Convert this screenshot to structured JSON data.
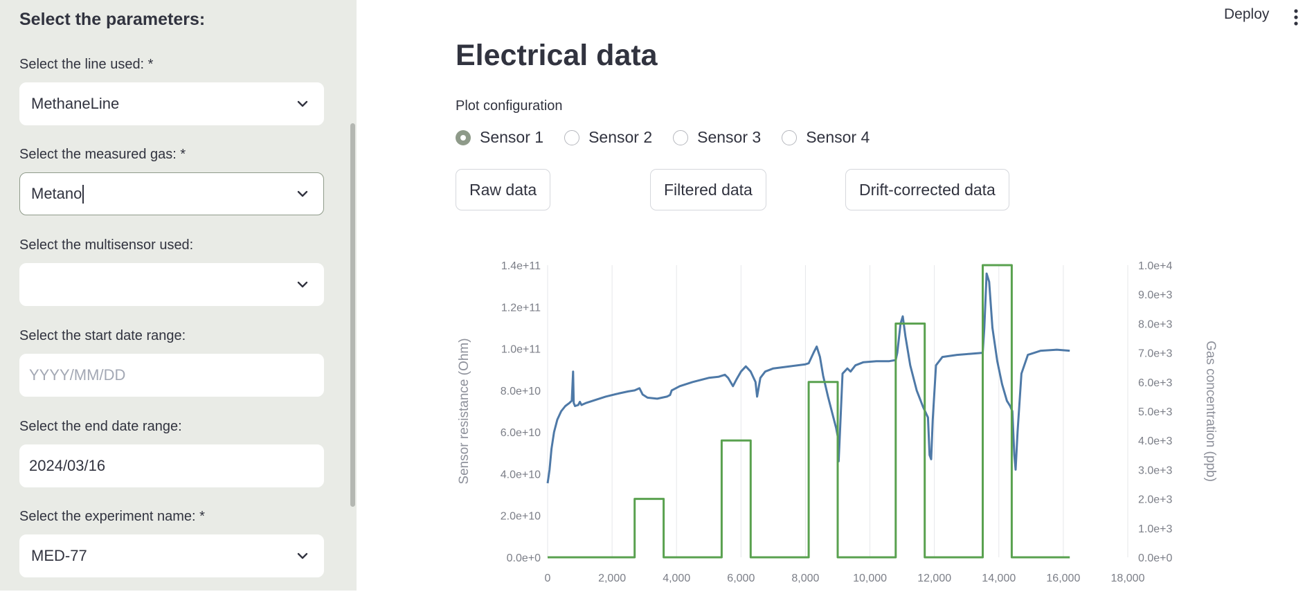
{
  "sidebar": {
    "header": "Select the parameters:",
    "line": {
      "label": "Select the line used: *",
      "value": "MethaneLine"
    },
    "gas": {
      "label": "Select the measured gas: *",
      "value": "Metano"
    },
    "multisensor": {
      "label": "Select the multisensor used:",
      "value": ""
    },
    "start_date": {
      "label": "Select the start date range:",
      "placeholder": "YYYY/MM/DD"
    },
    "end_date": {
      "label": "Select the end date range:",
      "value": "2024/03/16"
    },
    "experiment": {
      "label": "Select the experiment name: *",
      "value": "MED-77"
    }
  },
  "topbar": {
    "deploy_label": "Deploy",
    "menu_icon": "kebab-menu-icon"
  },
  "main": {
    "title": "Electrical data",
    "plot_config_label": "Plot configuration",
    "radios": [
      {
        "label": "Sensor 1",
        "checked": true
      },
      {
        "label": "Sensor 2",
        "checked": false
      },
      {
        "label": "Sensor 3",
        "checked": false
      },
      {
        "label": "Sensor 4",
        "checked": false
      }
    ],
    "buttons": {
      "raw": "Raw data",
      "filtered": "Filtered data",
      "drift": "Drift-corrected data"
    }
  },
  "colors": {
    "resistance_line": "#4e79a7",
    "concentration_line": "#59a14f",
    "accent": "#8e9a89",
    "sidebar_bg": "#e9ebe6"
  },
  "chart_data": {
    "type": "line",
    "xlabel": "",
    "ylabel": "Sensor resistance (Ohm)",
    "y2label": "Gas concentration (ppb)",
    "x_ticks": [
      "0",
      "2,000",
      "4,000",
      "6,000",
      "8,000",
      "10,000",
      "12,000",
      "14,000",
      "16,000",
      "18,000"
    ],
    "x_tick_values": [
      0,
      2000,
      4000,
      6000,
      8000,
      10000,
      12000,
      14000,
      16000,
      18000
    ],
    "y_ticks": [
      "0.0e+0",
      "2.0e+10",
      "4.0e+10",
      "6.0e+10",
      "8.0e+10",
      "1.0e+11",
      "1.2e+11",
      "1.4e+11"
    ],
    "y_tick_values": [
      0,
      20000000000,
      40000000000,
      60000000000,
      80000000000,
      100000000000,
      120000000000,
      140000000000
    ],
    "y2_ticks": [
      "0.0e+0",
      "1.0e+3",
      "2.0e+3",
      "3.0e+3",
      "4.0e+3",
      "5.0e+3",
      "6.0e+3",
      "7.0e+3",
      "8.0e+3",
      "9.0e+3",
      "1.0e+4"
    ],
    "y2_tick_values": [
      0,
      1000,
      2000,
      3000,
      4000,
      5000,
      6000,
      7000,
      8000,
      9000,
      10000
    ],
    "xlim": [
      0,
      18000
    ],
    "ylim": [
      0,
      140000000000
    ],
    "y2lim": [
      0,
      10000
    ],
    "grid": "vertical",
    "series": [
      {
        "axis": "left",
        "points": [
          [
            0,
            35500000000
          ],
          [
            60,
            42000000000
          ],
          [
            120,
            52000000000
          ],
          [
            200,
            60000000000
          ],
          [
            300,
            66000000000
          ],
          [
            420,
            70000000000
          ],
          [
            550,
            72500000000
          ],
          [
            680,
            74000000000
          ],
          [
            750,
            75000000000
          ],
          [
            790,
            89000000000
          ],
          [
            810,
            74000000000
          ],
          [
            850,
            72500000000
          ],
          [
            950,
            73000000000
          ],
          [
            1000,
            74500000000
          ],
          [
            1050,
            73000000000
          ],
          [
            1200,
            74000000000
          ],
          [
            1500,
            75500000000
          ],
          [
            1800,
            77000000000
          ],
          [
            2200,
            78500000000
          ],
          [
            2500,
            79500000000
          ],
          [
            2700,
            80000000000
          ],
          [
            2850,
            81000000000
          ],
          [
            2950,
            78000000000
          ],
          [
            3100,
            76500000000
          ],
          [
            3400,
            76000000000
          ],
          [
            3700,
            77000000000
          ],
          [
            3800,
            77800000000
          ],
          [
            3850,
            80000000000
          ],
          [
            4100,
            82000000000
          ],
          [
            4500,
            84000000000
          ],
          [
            5000,
            86000000000
          ],
          [
            5300,
            86500000000
          ],
          [
            5500,
            87500000000
          ],
          [
            5600,
            86000000000
          ],
          [
            5750,
            82000000000
          ],
          [
            5850,
            85000000000
          ],
          [
            6000,
            89000000000
          ],
          [
            6150,
            91500000000
          ],
          [
            6300,
            89000000000
          ],
          [
            6450,
            84000000000
          ],
          [
            6500,
            77000000000
          ],
          [
            6600,
            86000000000
          ],
          [
            6750,
            89000000000
          ],
          [
            7000,
            90500000000
          ],
          [
            7500,
            91500000000
          ],
          [
            8000,
            92500000000
          ],
          [
            8100,
            93000000000
          ],
          [
            8250,
            98000000000
          ],
          [
            8350,
            101000000000
          ],
          [
            8450,
            96000000000
          ],
          [
            8550,
            87000000000
          ],
          [
            8700,
            77000000000
          ],
          [
            8850,
            68000000000
          ],
          [
            8950,
            62000000000
          ],
          [
            9000,
            58000000000
          ],
          [
            9030,
            46000000000
          ],
          [
            9080,
            63000000000
          ],
          [
            9150,
            88000000000
          ],
          [
            9300,
            90500000000
          ],
          [
            9400,
            89000000000
          ],
          [
            9550,
            92000000000
          ],
          [
            9800,
            93500000000
          ],
          [
            10200,
            94000000000
          ],
          [
            10600,
            94000000000
          ],
          [
            10800,
            94500000000
          ],
          [
            10850,
            98000000000
          ],
          [
            10950,
            112000000000
          ],
          [
            11020,
            115500000000
          ],
          [
            11100,
            106000000000
          ],
          [
            11250,
            92000000000
          ],
          [
            11450,
            80000000000
          ],
          [
            11650,
            72000000000
          ],
          [
            11800,
            67000000000
          ],
          [
            11850,
            49000000000
          ],
          [
            11900,
            47000000000
          ],
          [
            11950,
            66000000000
          ],
          [
            12050,
            92000000000
          ],
          [
            12250,
            96000000000
          ],
          [
            12700,
            97000000000
          ],
          [
            13100,
            97500000000
          ],
          [
            13500,
            98000000000
          ],
          [
            13550,
            110000000000
          ],
          [
            13620,
            136000000000
          ],
          [
            13700,
            132000000000
          ],
          [
            13800,
            110000000000
          ],
          [
            13950,
            94000000000
          ],
          [
            14100,
            83000000000
          ],
          [
            14250,
            75000000000
          ],
          [
            14350,
            72500000000
          ],
          [
            14420,
            70000000000
          ],
          [
            14480,
            49000000000
          ],
          [
            14520,
            42000000000
          ],
          [
            14580,
            60000000000
          ],
          [
            14700,
            88000000000
          ],
          [
            14900,
            97000000000
          ],
          [
            15300,
            99000000000
          ],
          [
            15800,
            99500000000
          ],
          [
            16200,
            99000000000
          ]
        ]
      },
      {
        "axis": "right",
        "points": [
          [
            0,
            0
          ],
          [
            2700,
            0
          ],
          [
            2700,
            2000
          ],
          [
            3600,
            2000
          ],
          [
            3600,
            0
          ],
          [
            5400,
            0
          ],
          [
            5400,
            4000
          ],
          [
            6300,
            4000
          ],
          [
            6300,
            0
          ],
          [
            8100,
            0
          ],
          [
            8100,
            6000
          ],
          [
            9000,
            6000
          ],
          [
            9000,
            0
          ],
          [
            10800,
            0
          ],
          [
            10800,
            8000
          ],
          [
            11700,
            8000
          ],
          [
            11700,
            0
          ],
          [
            13500,
            0
          ],
          [
            13500,
            10000
          ],
          [
            14400,
            10000
          ],
          [
            14400,
            0
          ],
          [
            16200,
            0
          ]
        ]
      }
    ]
  }
}
